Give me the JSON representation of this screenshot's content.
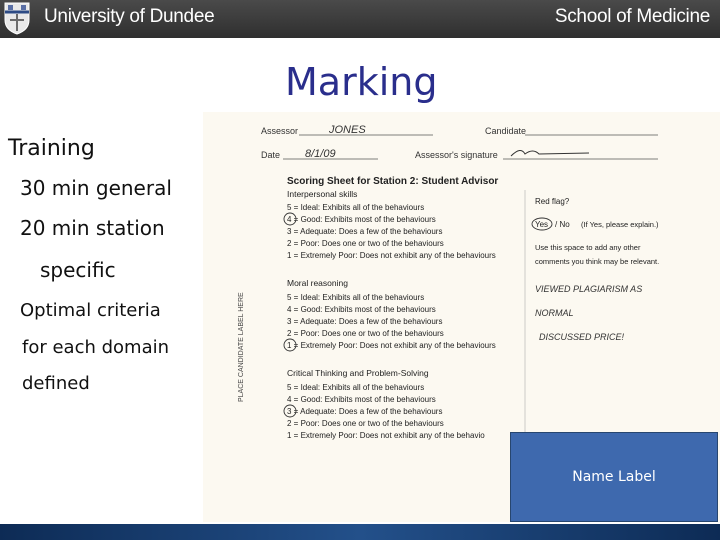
{
  "header": {
    "university": "University of Dundee",
    "school": "School of Medicine"
  },
  "slide": {
    "title": "Marking",
    "bullets": [
      "Training",
      "30 min general",
      "20 min station",
      "specific",
      "Optimal criteria",
      "for each domain",
      "defined"
    ]
  },
  "sheet": {
    "assessor_label": "Assessor",
    "assessor_value": "JONES",
    "candidate_label": "Candidate",
    "date_label": "Date",
    "date_value": "8/1/09",
    "signature_label": "Assessor's signature",
    "side_label": "PLACE CANDIDATE LABEL HERE",
    "heading": "Scoring Sheet for Station 2: Student Advisor",
    "sections": [
      {
        "title": "Interpersonal skills",
        "items": [
          "5 = Ideal: Exhibits all of the behaviours",
          "4 = Good: Exhibits most of the behaviours",
          "3 = Adequate: Does a few of the behaviours",
          "2 = Poor: Does one or two of the behaviours",
          "1 = Extremely Poor: Does not exhibit any of the behaviours"
        ]
      },
      {
        "title": "Moral reasoning",
        "items": [
          "5 = Ideal: Exhibits all of the behaviours",
          "4 = Good: Exhibits most of the behaviours",
          "3 = Adequate: Does a few of the behaviours",
          "2 = Poor: Does one or two of the behaviours",
          "1 = Extremely Poor: Does not exhibit any of the behaviours"
        ]
      },
      {
        "title": "Critical Thinking and Problem-Solving",
        "items": [
          "5 = Ideal: Exhibits all of the behaviours",
          "4 = Good: Exhibits most of the behaviours",
          "3 = Adequate: Does a few of the behaviours",
          "2 = Poor: Does one or two of the behaviours",
          "1 = Extremely Poor: Does not exhibit any of the behavio"
        ]
      }
    ],
    "red_flag_label": "Red flag?",
    "red_flag_yes": "Yes",
    "red_flag_no": "/ No",
    "red_flag_note": "(If Yes, please explain.)",
    "comment_hint_1": "Use this space to add any other",
    "comment_hint_2": "comments you think may be relevant.",
    "handwritten_1": "VIEWED PLAGIARISM AS",
    "handwritten_2": "NORMAL",
    "handwritten_3": "DISCUSSED PRICE!"
  },
  "name_label": "Name Label",
  "colors": {
    "header_bg": "#3a3a3a",
    "title": "#2a2e8c",
    "name_label_bg": "#3e69ae",
    "footer": "#1a3f70"
  }
}
